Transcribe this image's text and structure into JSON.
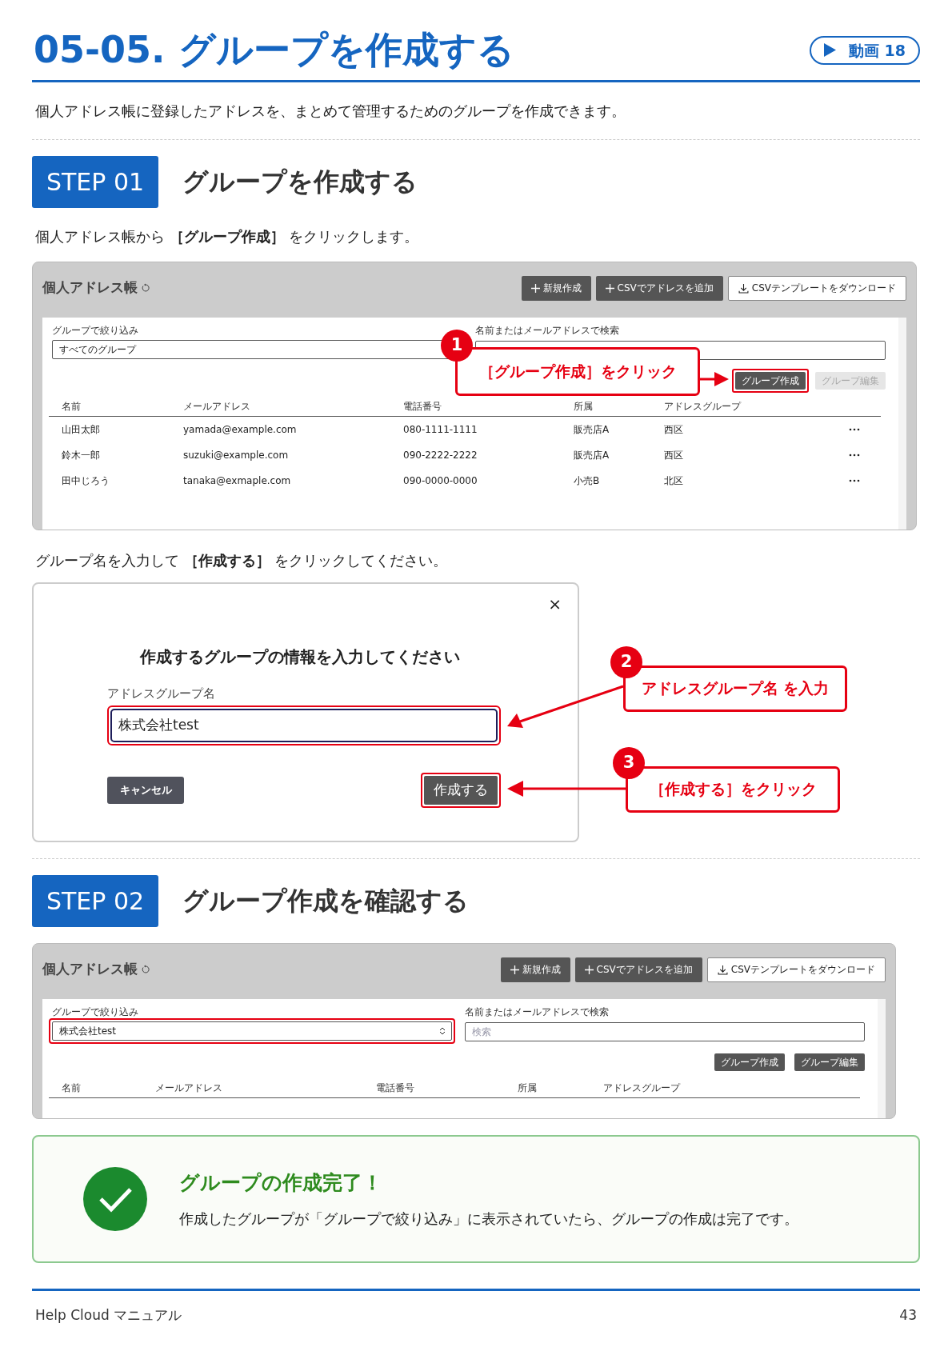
{
  "header": {
    "title": "05-05. グループを作成する",
    "video_label": "動画 18"
  },
  "intro": "個人アドレス帳に登録したアドレスを、まとめて管理するためのグループを作成できます。",
  "step1": {
    "badge": "STEP 01",
    "heading": "グループを作成する",
    "instruction": "個人アドレス帳から **［グループ作成］** をクリックします。"
  },
  "screenshot1": {
    "title": "個人アドレス帳",
    "buttons": [
      {
        "label": "新規作成",
        "kind": "plus"
      },
      {
        "label": "CSVでアドレスを追加",
        "kind": "plus"
      },
      {
        "label": "CSVテンプレートをダウンロード",
        "kind": "download"
      }
    ],
    "filter": {
      "label": "グループで絞り込み",
      "value": "すべてのグループ",
      "kind": "input",
      "highlighted": false
    },
    "search": {
      "label": "名前またはメールアドレスで検索"
    },
    "group_buttons": [
      {
        "label": "グループ作成",
        "disabled": false,
        "highlighted": true
      },
      {
        "label": "グループ編集",
        "disabled": true,
        "highlighted": false
      }
    ],
    "columns": [
      "名前",
      "メールアドレス",
      "電話番号",
      "所属",
      "アドレスグループ"
    ],
    "rows": [
      [
        "山田太郎",
        "yamada@example.com",
        "080-1111-1111",
        "販売店A",
        "西区"
      ],
      [
        "鈴木一郎",
        "suzuki@example.com",
        "090-2222-2222",
        "販売店A",
        "西区"
      ],
      [
        "田中じろう",
        "tanaka@exmaple.com",
        "090-0000-0000",
        "小売B",
        "北区"
      ]
    ],
    "callout": {
      "number": "1",
      "text": "［グループ作成］をクリック"
    }
  },
  "instruction2": "グループ名を入力して **［作成する］** をクリックしてください。",
  "dialog": {
    "close": "×",
    "heading": "作成するグループの情報を入力してください",
    "field_label": "アドレスグループ名",
    "field_value": "株式会社test",
    "cancel": "キャンセル",
    "submit": "作成する",
    "callouts": [
      {
        "number": "2",
        "text": "アドレスグループ名 を入力"
      },
      {
        "number": "3",
        "text": "［作成する］をクリック"
      }
    ]
  },
  "step2": {
    "badge": "STEP 02",
    "heading": "グループ作成を確認する"
  },
  "screenshot2": {
    "title": "個人アドレス帳",
    "buttons": [
      {
        "label": "新規作成",
        "kind": "plus"
      },
      {
        "label": "CSVでアドレスを追加",
        "kind": "plus"
      },
      {
        "label": "CSVテンプレートをダウンロード",
        "kind": "download"
      }
    ],
    "filter": {
      "label": "グループで絞り込み",
      "value": "株式会社test",
      "kind": "select",
      "highlighted": true
    },
    "search": {
      "label": "名前またはメールアドレスで検索",
      "placeholder": "検索"
    },
    "group_buttons": [
      {
        "label": "グループ作成",
        "disabled": false,
        "highlighted": false
      },
      {
        "label": "グループ編集",
        "disabled": false,
        "highlighted": false
      }
    ],
    "columns": [
      "名前",
      "メールアドレス",
      "電話番号",
      "所属",
      "アドレスグループ"
    ]
  },
  "success": {
    "heading": "グループの作成完了！",
    "text": "作成したグループが「グループで絞り込み」に表示されていたら、グループの作成は完了です。"
  },
  "footer": {
    "left": "Help Cloud マニュアル",
    "page": "43"
  }
}
